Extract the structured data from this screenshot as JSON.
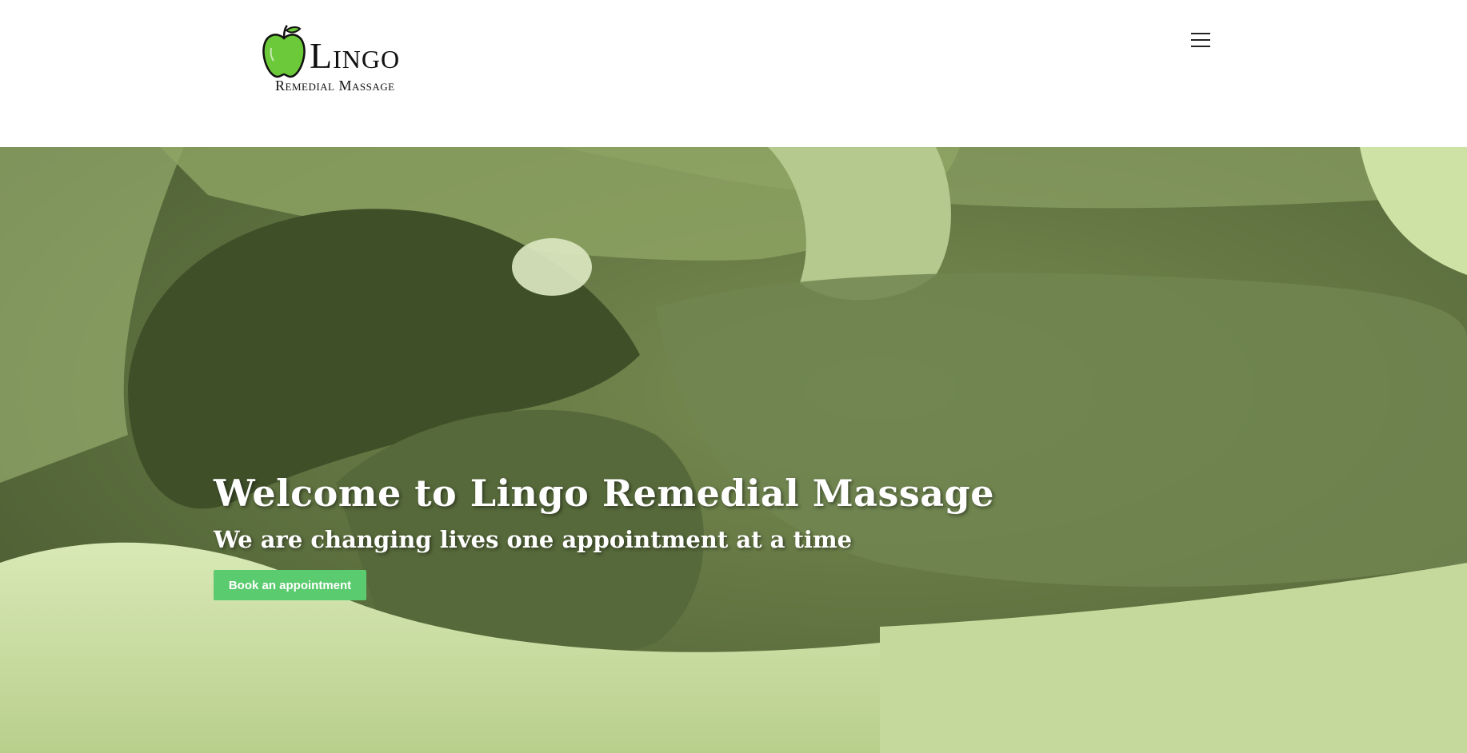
{
  "header": {
    "brand_name": "Lingo",
    "brand_sub": "Remedial Massage",
    "logo_icon": "apple-icon",
    "menu_icon": "hamburger-menu-icon"
  },
  "hero": {
    "title": "Welcome to Lingo Remedial Massage",
    "subtitle": "We are changing lives one appointment at a time",
    "cta_label": "Book an appointment",
    "overlay_color": "#6b7e48"
  },
  "colors": {
    "accent": "#5bcb6f",
    "logo_apple": "#6cc93a"
  }
}
